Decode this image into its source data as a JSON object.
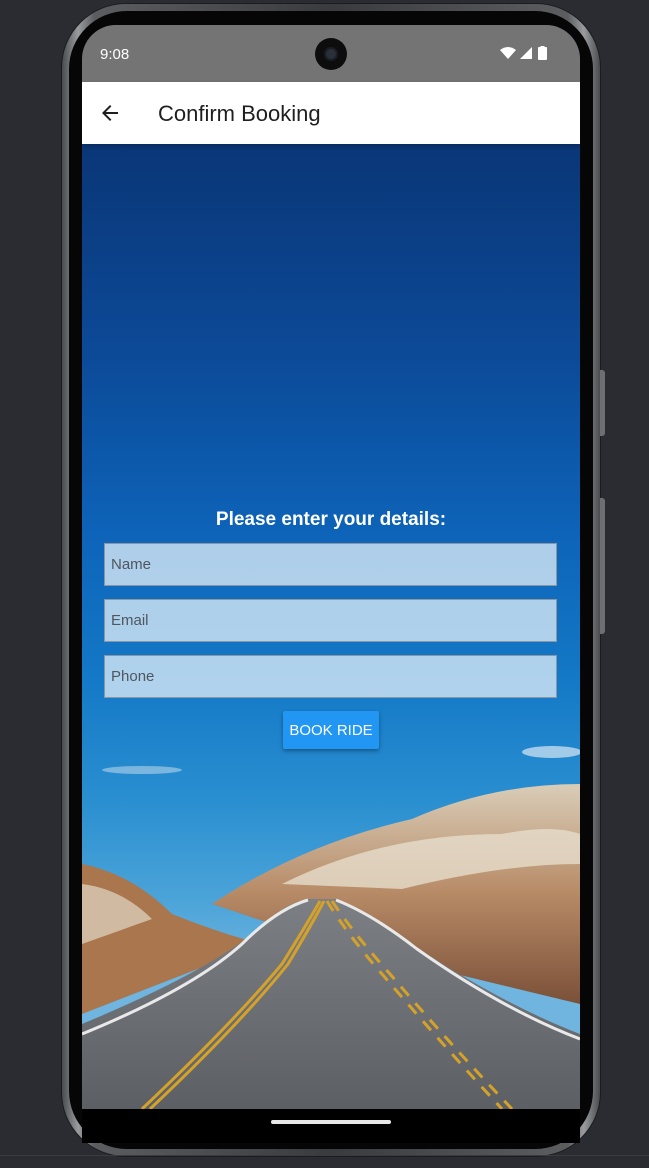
{
  "status_bar": {
    "time": "9:08",
    "icons": [
      "wifi-icon",
      "cell-signal-icon",
      "battery-icon"
    ]
  },
  "app_bar": {
    "back_icon": "arrow-back-icon",
    "title": "Confirm Booking"
  },
  "form": {
    "heading": "Please enter your details:",
    "name_placeholder": "Name",
    "email_placeholder": "Email",
    "phone_placeholder": "Phone",
    "submit_label": "BOOK RIDE"
  },
  "colors": {
    "accent": "#2196f3",
    "status_bar": "#747474",
    "app_bar": "#ffffff"
  }
}
